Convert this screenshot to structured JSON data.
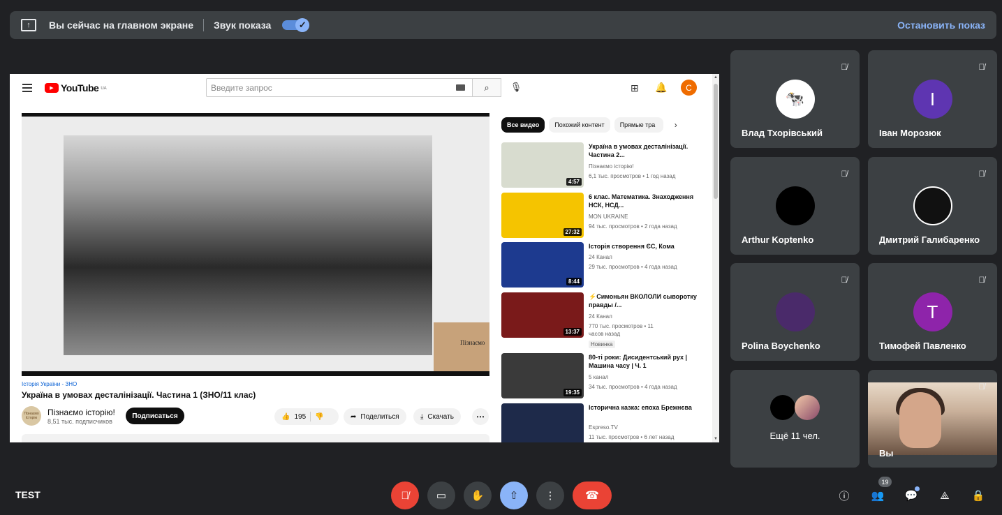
{
  "present_bar": {
    "status_text": "Вы сейчас на главном экране",
    "audio_label": "Звук показа",
    "audio_on": true,
    "stop_label": "Остановить показ"
  },
  "youtube": {
    "logo_text": "YouTube",
    "region": "UA",
    "search_placeholder": "Введите запрос",
    "avatar_letter": "C",
    "video": {
      "category": "Історія України - ЗНО",
      "title": "Україна в умовах десталінізації. Частина 1 (ЗНО/11 клас)",
      "channel": "Пізнаємо історію!",
      "subscribers": "8,51 тыс. подписчиков",
      "subscribe_label": "Подписаться",
      "likes": "195",
      "share_label": "Поделиться",
      "download_label": "Скачать",
      "watermark": "Пізнаємо",
      "channel_avatar_text": "Пізнаємо Історію"
    },
    "chips": [
      "Все видео",
      "Похожий контент",
      "Прямые тра"
    ],
    "recommendations": [
      {
        "title": "Україна в умовах десталінізації. Частина 2...",
        "channel": "Пізнаємо історію!",
        "meta": "6,1 тыс. просмотров • 1 год назад",
        "duration": "4:57",
        "thumb_color": "#d8dccf"
      },
      {
        "title": "6 клас. Математика. Знаходження НСК, НСД...",
        "channel": "MON UKRAINE",
        "meta": "94 тыс. просмотров • 2 года назад",
        "duration": "27:32",
        "thumb_color": "#f5c400"
      },
      {
        "title": "Історія створення ЄС, Кома",
        "channel": "24 Канал",
        "meta": "29 тыс. просмотров • 4 года назад",
        "duration": "8:44",
        "thumb_color": "#1d3a8f"
      },
      {
        "title": "⚡Симоньян ВКОЛОЛИ сыворотку правды /...",
        "channel": "24 Канал",
        "meta": "770 тыс. просмотров • 11 часов назад",
        "duration": "13:37",
        "thumb_color": "#7a1a1a",
        "badge": "Новинка"
      },
      {
        "title": "80-ті роки: Дисидентський рух | Машина часу | Ч. 1",
        "channel": "5 канал",
        "meta": "34 тыс. просмотров • 4 года назад",
        "duration": "19:35",
        "thumb_color": "#3a3a3a"
      },
      {
        "title": "Історична казка: епоха Брежнєва",
        "channel": "Espreso.TV",
        "meta": "11 тыс. просмотров • 6 лет назад",
        "duration": "",
        "thumb_color": "#1e2a4a"
      }
    ]
  },
  "participants": [
    {
      "name": "Влад Тхорівський",
      "avatar_color": "#ffffff",
      "letter": "",
      "muted": true
    },
    {
      "name": "Іван Морозюк",
      "avatar_color": "#5e35b1",
      "letter": "I",
      "muted": true
    },
    {
      "name": "Arthur Koptenko",
      "avatar_color": "#000000",
      "letter": "",
      "muted": true
    },
    {
      "name": "Дмитрий Галибаренко",
      "avatar_color": "#111111",
      "letter": "",
      "muted": true
    },
    {
      "name": "Polina Boychenko",
      "avatar_color": "#4a2a6a",
      "letter": "",
      "muted": true
    },
    {
      "name": "Тимофей Павленко",
      "avatar_color": "#8e24aa",
      "letter": "T",
      "muted": true
    }
  ],
  "more_participants": "Ещё 11 чел.",
  "self_label": "Вы",
  "meeting": {
    "name": "TEST",
    "people_count": "19"
  }
}
